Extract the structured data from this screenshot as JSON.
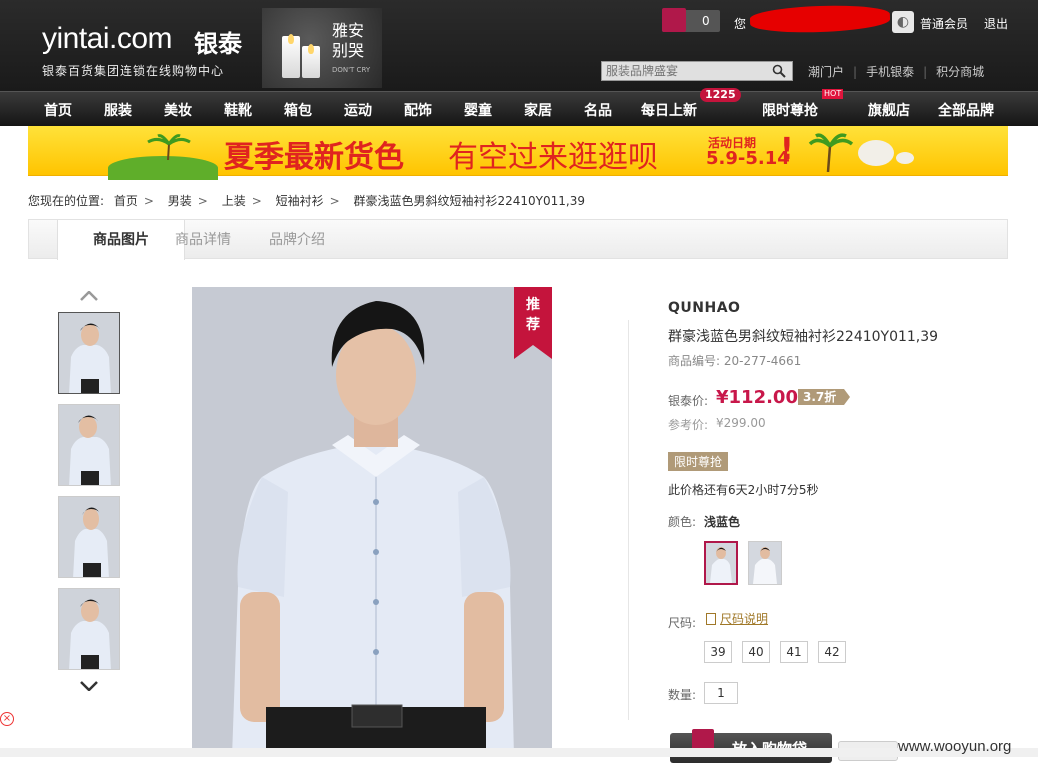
{
  "header": {
    "logo_text": "yintai.com",
    "logo_cn": "银泰",
    "logo_sub": "银泰百货集团连锁在线购物中心",
    "promo_text_1": "雅安",
    "promo_text_2": "别哭",
    "promo_small": "DON'T CRY",
    "cart_count": "0",
    "greeting": "您",
    "member_level": "普通会员",
    "logout": "退出",
    "search_placeholder": "服装品牌盛宴",
    "links": [
      "潮门户",
      "手机银泰",
      "积分商城"
    ]
  },
  "nav": {
    "items": [
      "首页",
      "服装",
      "美妆",
      "鞋靴",
      "箱包",
      "运动",
      "配饰",
      "婴童",
      "家居",
      "名品",
      "每日上新",
      "限时尊抢",
      "旗舰店",
      "全部品牌"
    ],
    "new_badge": "1225",
    "hot_badge": "HOT"
  },
  "banner": {
    "text1": "夏季最新货色",
    "text2": "有空过来逛逛呗",
    "date_label": "活动日期",
    "date": "5.9-5.14",
    "exclaim": "!"
  },
  "breadcrumb": {
    "label": "您现在的位置:",
    "items": [
      "首页",
      "男装",
      "上装",
      "短袖衬衫",
      "群豪浅蓝色男斜纹短袖衬衫22410Y011,39"
    ]
  },
  "tabs": [
    "商品图片",
    "商品详情",
    "品牌介绍"
  ],
  "product": {
    "badge": "推荐",
    "brand": "QUNHAO",
    "name": "群豪浅蓝色男斜纹短袖衬衫22410Y011,39",
    "code": "商品编号: 20-277-4661",
    "price_label": "银泰价:",
    "price": "¥112.00",
    "discount": "3.7折",
    "ref_label": "参考价:",
    "ref_price": "¥299.00",
    "flash_tag": "限时尊抢",
    "countdown": "此价格还有6天2小时7分5秒",
    "color_label": "颜色:",
    "color_value": "浅蓝色",
    "size_label": "尺码:",
    "size_guide": "尺码说明",
    "sizes": [
      "39",
      "40",
      "41",
      "42"
    ],
    "qty_label": "数量:",
    "qty": "1",
    "add_to_cart": "放入购物袋"
  },
  "footer": {
    "watermark": "www.wooyun.org",
    "close_glyph": "×"
  },
  "colors": {
    "accent": "#c8174a",
    "tag": "#b09a78",
    "banner_red": "#e0241f",
    "banner_yellow": "#ffd21a"
  }
}
